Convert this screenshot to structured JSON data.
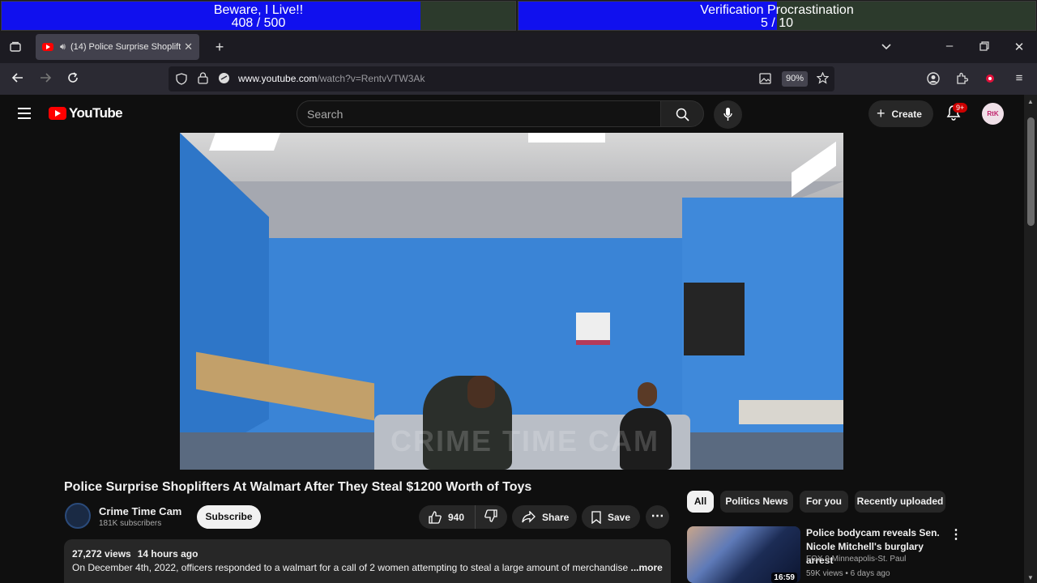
{
  "overlay": {
    "bar1": {
      "title": "Beware, I Live!!",
      "progress": "408 / 500",
      "fraction": 0.816
    },
    "bar2": {
      "title": "Verification Procrastination",
      "progress": "5 / 10",
      "fraction": 0.5
    }
  },
  "browser": {
    "tab_title": "(14) Police Surprise Shoplift",
    "url_host": "www.youtube.com",
    "url_path": "/watch?v=RentvVTW3Ak",
    "zoom": "90%"
  },
  "youtube": {
    "logo_text": "YouTube",
    "search_placeholder": "Search",
    "create_label": "Create",
    "notif_badge": "9+",
    "avatar_text": "RtK"
  },
  "video": {
    "watermark": "CRIME TIME CAM",
    "title": "Police Surprise Shoplifters At Walmart After They Steal $1200 Worth of Toys",
    "channel": "Crime Time Cam",
    "subscribers": "181K subscribers",
    "subscribe_label": "Subscribe",
    "likes": "940",
    "share_label": "Share",
    "save_label": "Save",
    "views": "27,272 views",
    "age": "14 hours ago",
    "description": "On December 4th, 2022, officers responded to a walmart for a call of 2 women attempting to steal a large amount of merchandise ",
    "more_label": "...more"
  },
  "chips": [
    "All",
    "Politics News",
    "For you",
    "Recently uploaded"
  ],
  "recommendation": {
    "title": "Police bodycam reveals Sen. Nicole Mitchell's burglary arrest",
    "channel": "FOX 9 Minneapolis-St. Paul",
    "views": "59K views • 6 days ago",
    "duration": "16:59"
  }
}
